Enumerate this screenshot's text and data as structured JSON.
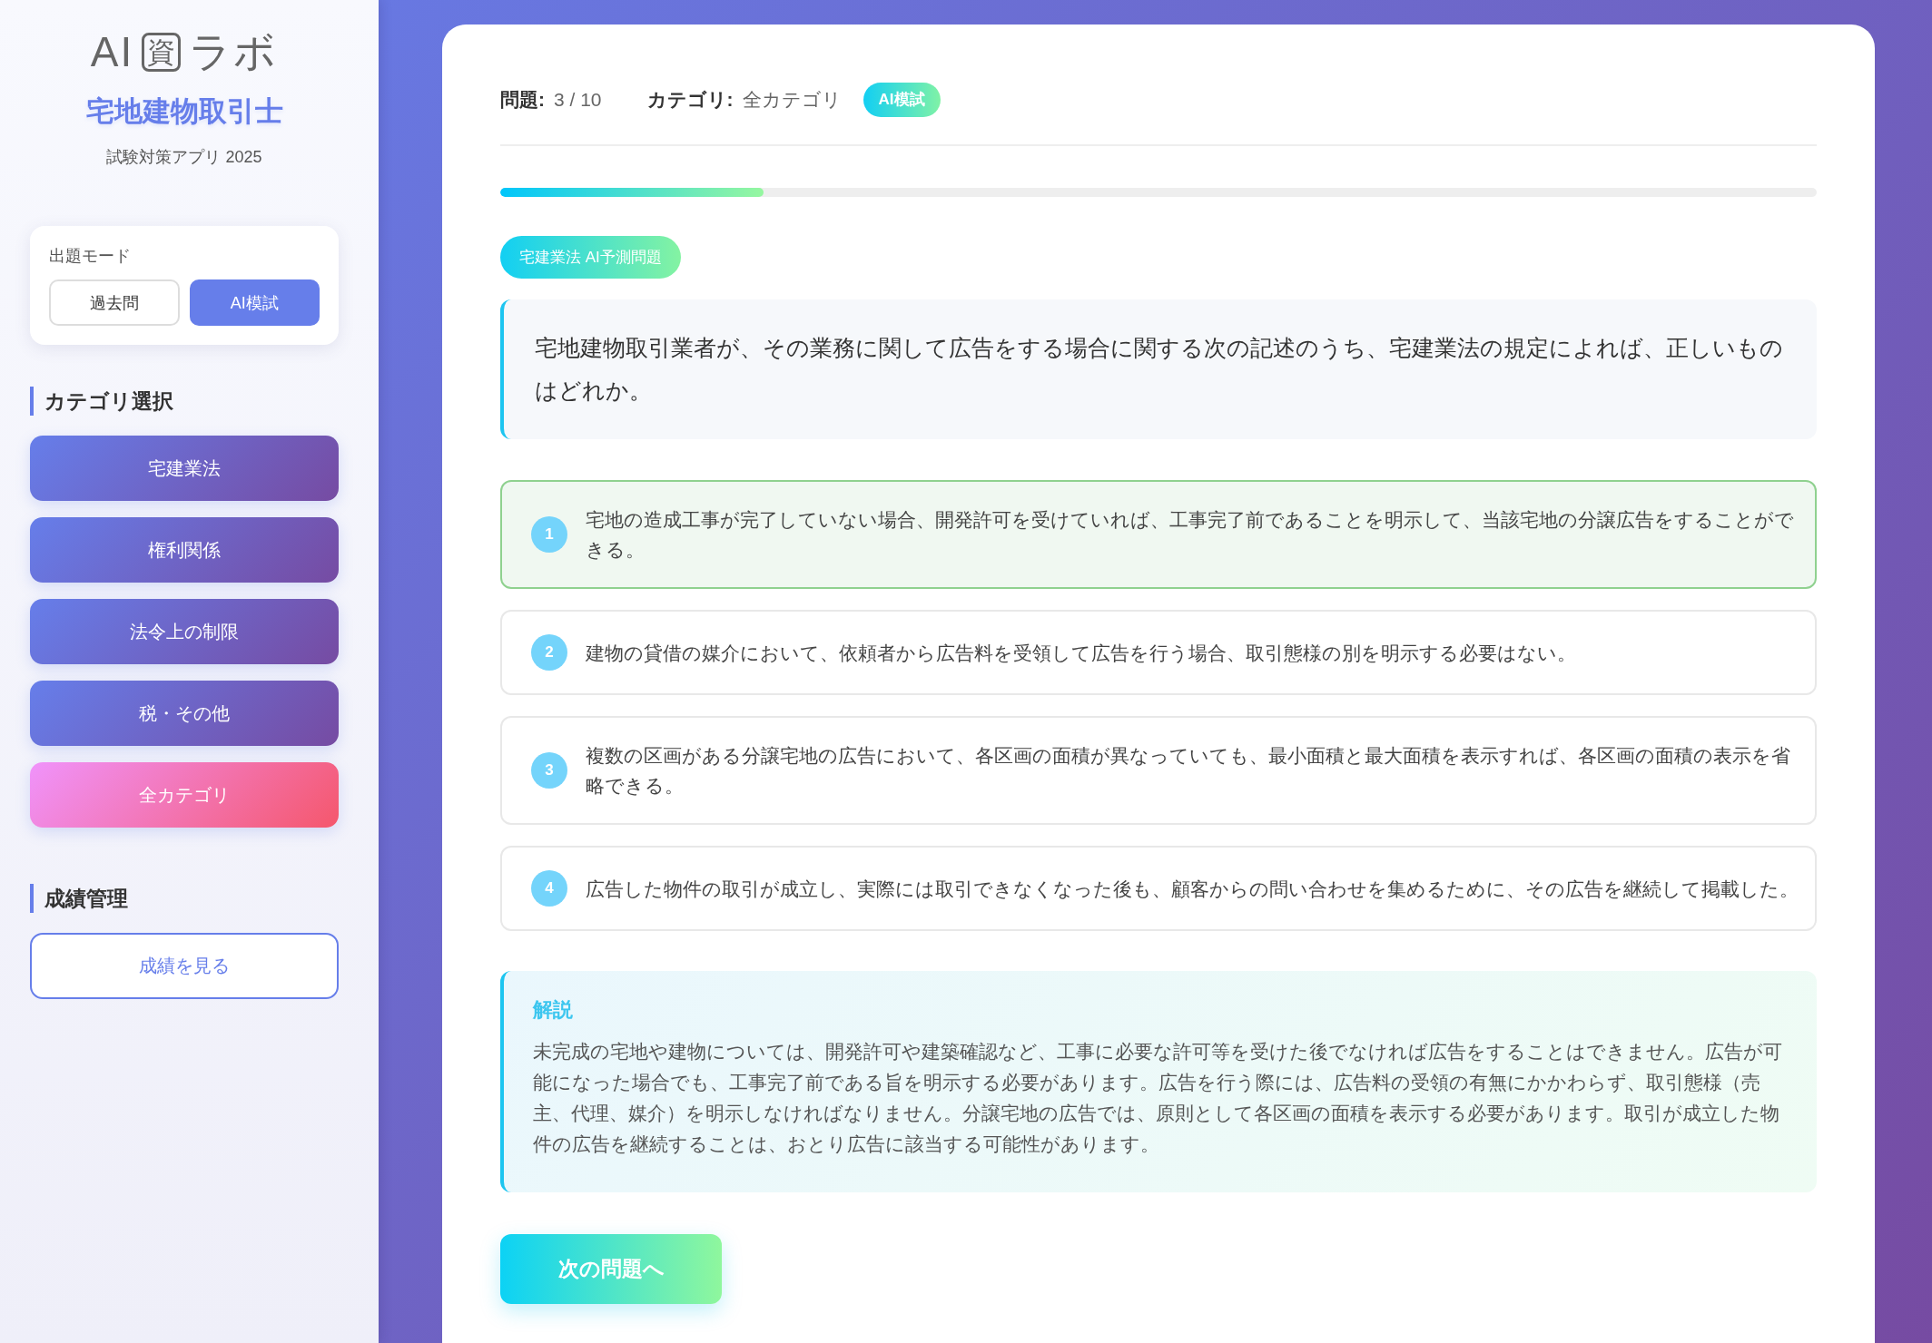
{
  "sidebar": {
    "logo": [
      {
        "text": "AI",
        "boxed": false
      },
      {
        "text": "資",
        "boxed": true
      },
      {
        "text": "ラボ",
        "boxed": false
      }
    ],
    "title": "宅地建物取引士",
    "subtitle": "試験対策アプリ 2025",
    "mode_panel": {
      "label": "出題モード",
      "options": [
        {
          "label": "過去問",
          "selected": false
        },
        {
          "label": "AI模試",
          "selected": true
        }
      ]
    },
    "sections": [
      {
        "heading": "カテゴリ選択",
        "items": [
          {
            "kind": "filled",
            "label": "宅建業法",
            "selected": false
          },
          {
            "kind": "filled",
            "label": "権利関係",
            "selected": false
          },
          {
            "kind": "filled",
            "label": "法令上の制限",
            "selected": false
          },
          {
            "kind": "filled",
            "label": "税・その他",
            "selected": false
          },
          {
            "kind": "filled",
            "label": "全カテゴリ",
            "selected": true
          }
        ]
      },
      {
        "heading": "成績管理",
        "items": [
          {
            "kind": "outline",
            "label": "成績を見る"
          }
        ]
      }
    ]
  },
  "main": {
    "header": {
      "question_label": "問題:",
      "question_value": "3 / 10",
      "category_label": "カテゴリ:",
      "category_value": "全カテゴリ",
      "mode_badge": "AI模試"
    },
    "progress": {
      "level": 0.2
    },
    "tag": "宅建業法 AI予測問題",
    "question": "宅地建物取引業者が、その業務に関して広告をする場合に関する次の記述のうち、宅建業法の規定によれば、正しいものはどれか。",
    "options": [
      {
        "number": "1",
        "text": "宅地の造成工事が完了していない場合、開発許可を受けていれば、工事完了前であることを明示して、当該宅地の分譲広告をすることができる。",
        "selected": true
      },
      {
        "number": "2",
        "text": "建物の貸借の媒介において、依頼者から広告料を受領して広告を行う場合、取引態様の別を明示する必要はない。",
        "selected": false
      },
      {
        "number": "3",
        "text": "複数の区画がある分譲宅地の広告において、各区画の面積が異なっていても、最小面積と最大面積を表示すれば、各区画の面積の表示を省略できる。",
        "selected": false
      },
      {
        "number": "4",
        "text": "広告した物件の取引が成立し、実際には取引できなくなった後も、顧客からの問い合わせを集めるために、その広告を継続して掲載した。",
        "selected": false
      }
    ],
    "explanation": {
      "title": "解説",
      "text": "未完成の宅地や建物については、開発許可や建築確認など、工事に必要な許可等を受けた後でなければ広告をすることはできません。広告が可能になった場合でも、工事完了前である旨を明示する必要があります。広告を行う際には、広告料の受領の有無にかかわらず、取引態様（売主、代理、媒介）を明示しなければなりません。分譲宅地の広告では、原則として各区画の面積を表示する必要があります。取引が成立した物件の広告を継続することは、おとり広告に該当する可能性があります。"
    },
    "next_button": "次の問題へ"
  }
}
